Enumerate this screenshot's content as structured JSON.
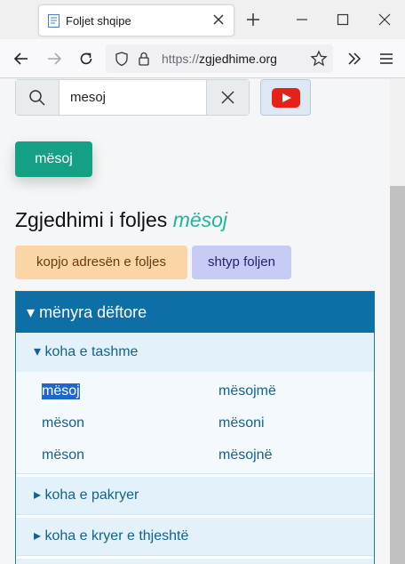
{
  "browser": {
    "tab_title": "Foljet shqipe",
    "url_scheme": "https://",
    "url_host": "zgjedhime.org"
  },
  "search": {
    "value": "mesoj"
  },
  "page": {
    "verb_button": "mësoj",
    "heading_prefix": "Zgjedhimi i foljes",
    "heading_verb": "mësoj",
    "copy_button": "kopjo adresën e foljes",
    "print_button": "shtyp foljen"
  },
  "mood": {
    "label": "mënyra dëftore",
    "open_tense": {
      "label": "koha e tashme",
      "forms": [
        "mësoj",
        "mëson",
        "mëson",
        "mësojmë",
        "mësoni",
        "mësojnë"
      ]
    },
    "closed_tenses": [
      "koha e pakryer",
      "koha e kryer e thjeshtë"
    ]
  },
  "colors": {
    "accent": "#14a085",
    "mood_header": "#0e6fa6",
    "link_text": "#14628f"
  }
}
